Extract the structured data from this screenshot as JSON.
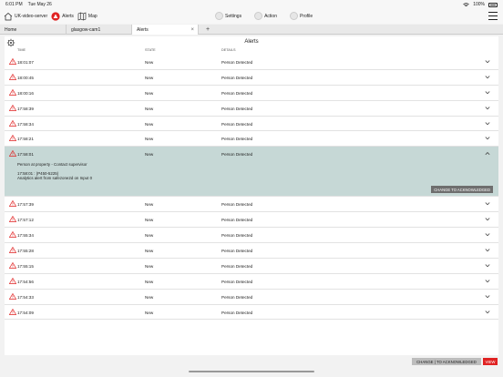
{
  "status_bar": {
    "time": "6:01 PM",
    "date": "Tue May 26",
    "battery": "100%"
  },
  "toolbar": {
    "server_label": "UK-video-server",
    "alerts_label": "Alerts",
    "map_label": "Map",
    "settings_label": "Settings",
    "action_label": "Action",
    "profile_label": "Profile"
  },
  "tabs": [
    {
      "label": "Home"
    },
    {
      "label": "glasgow-cam1"
    },
    {
      "label": "Alerts"
    },
    {
      "label": "+"
    }
  ],
  "panel": {
    "title": "Alerts",
    "columns": {
      "time": "TIME",
      "state": "STATE",
      "details": "DETAILS"
    }
  },
  "rows_before": [
    {
      "time": "18:01:07",
      "state": "New",
      "details": "Person Detected"
    },
    {
      "time": "18:00:45",
      "state": "New",
      "details": "Person Detected"
    },
    {
      "time": "18:00:16",
      "state": "New",
      "details": "Person Detected"
    },
    {
      "time": "17:58:39",
      "state": "New",
      "details": "Person Detected"
    },
    {
      "time": "17:58:34",
      "state": "New",
      "details": "Person Detected"
    },
    {
      "time": "17:58:21",
      "state": "New",
      "details": "Person Detected"
    }
  ],
  "expanded": {
    "time": "17:58:01",
    "state": "New",
    "details": "Person Detected",
    "message": "Person at property - Contact supervisor",
    "device": "17:58:01 : (P450-5225)",
    "source": "Analytics alert from safezone2d on Input 0",
    "ack_label": "CHANGE TO ACKNOWLEDGED"
  },
  "rows_after": [
    {
      "time": "17:57:39",
      "state": "New",
      "details": "Person Detected"
    },
    {
      "time": "17:57:12",
      "state": "New",
      "details": "Person Detected"
    },
    {
      "time": "17:55:34",
      "state": "New",
      "details": "Person Detected"
    },
    {
      "time": "17:55:28",
      "state": "New",
      "details": "Person Detected"
    },
    {
      "time": "17:55:15",
      "state": "New",
      "details": "Person Detected"
    },
    {
      "time": "17:54:56",
      "state": "New",
      "details": "Person Detected"
    },
    {
      "time": "17:54:33",
      "state": "New",
      "details": "Person Detected"
    },
    {
      "time": "17:54:09",
      "state": "New",
      "details": "Person Detected"
    }
  ],
  "bottom": {
    "change_label": "CHANGE | TO ACKNOWLEDGED",
    "view_label": "VIEW"
  },
  "colors": {
    "accent": "#e02222",
    "expanded_bg": "#c6d8d6"
  }
}
